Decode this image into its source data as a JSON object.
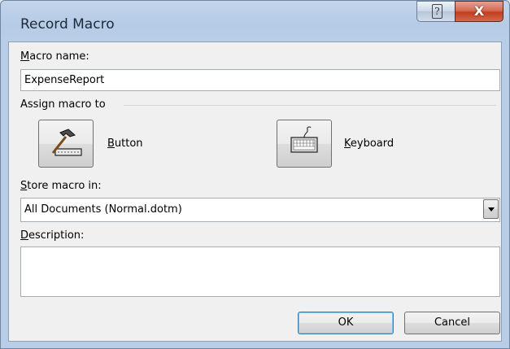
{
  "window": {
    "title": "Record Macro",
    "help_glyph": "?",
    "close_glyph": "X"
  },
  "macro_name": {
    "label_prefix": "",
    "label_key": "M",
    "label_rest": "acro name:",
    "value": "ExpenseReport"
  },
  "assign": {
    "heading": "Assign macro to",
    "button": {
      "label_key": "B",
      "label_rest": "utton",
      "icon": "hammer-icon"
    },
    "keyboard": {
      "label_key": "K",
      "label_rest": "eyboard",
      "icon": "keyboard-icon"
    }
  },
  "store": {
    "label_key": "S",
    "label_rest": "tore macro in:",
    "selected": "All Documents (Normal.dotm)"
  },
  "description": {
    "label_key": "D",
    "label_rest": "escription:",
    "value": ""
  },
  "actions": {
    "ok": "OK",
    "cancel": "Cancel"
  }
}
